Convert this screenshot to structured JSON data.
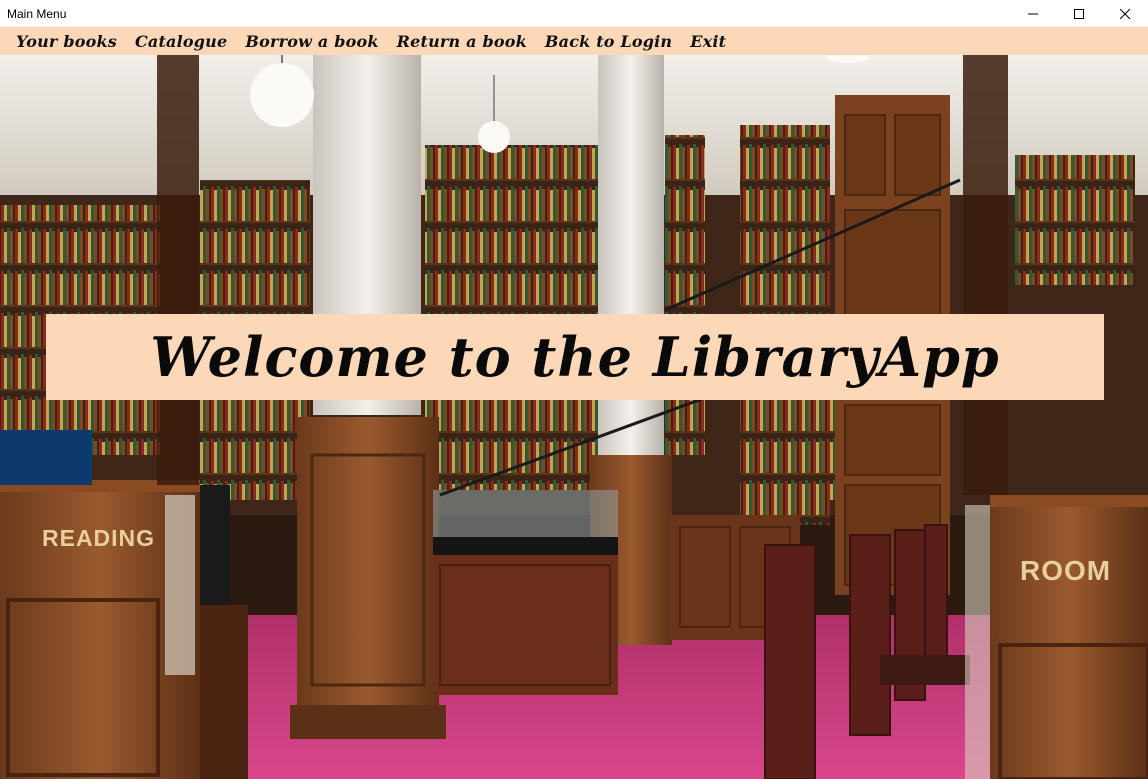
{
  "window": {
    "title": "Main Menu",
    "controls": {
      "minimize": "minimize-icon",
      "maximize": "maximize-icon",
      "close": "close-icon"
    }
  },
  "menu": {
    "items": [
      {
        "label": "Your books"
      },
      {
        "label": "Catalogue"
      },
      {
        "label": "Borrow a book"
      },
      {
        "label": "Return a book"
      },
      {
        "label": "Back to Login"
      },
      {
        "label": "Exit"
      }
    ]
  },
  "banner": {
    "text": "Welcome to the LibraryApp"
  },
  "background_signs": {
    "left": "READING",
    "right": "ROOM"
  },
  "colors": {
    "menu_bg": "#fdd8b8",
    "banner_bg": "#fdd8b8",
    "carpet": "#c23a6e"
  }
}
